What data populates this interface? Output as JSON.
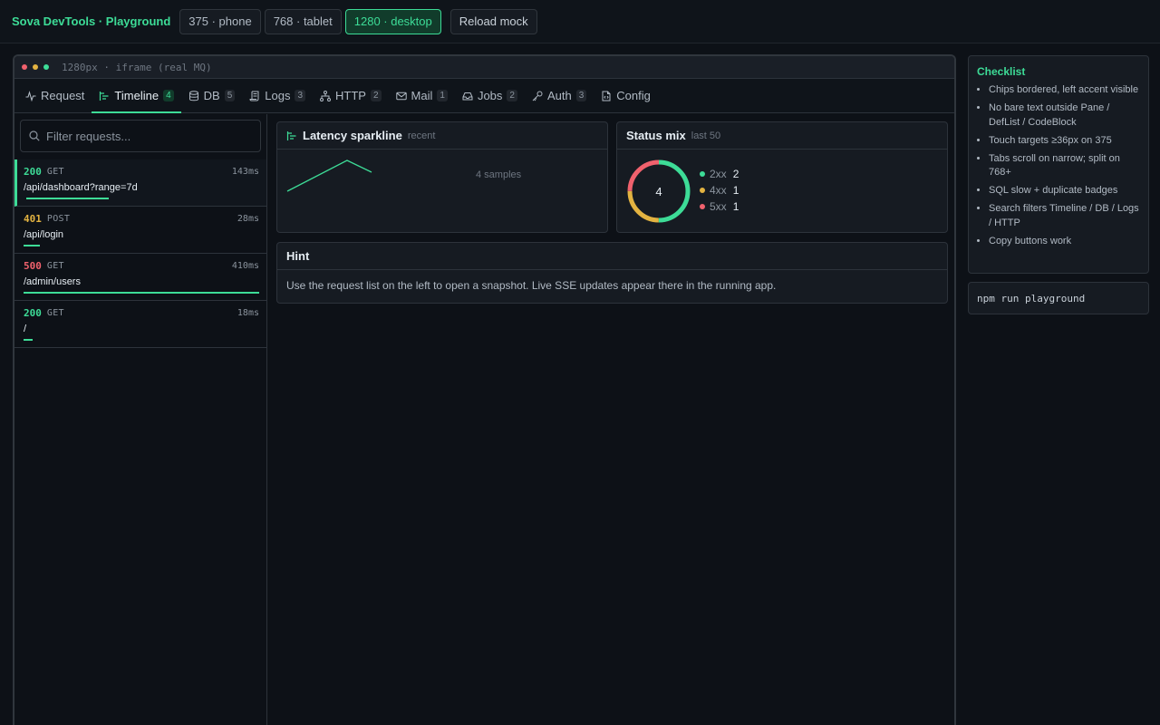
{
  "app": {
    "title": "Sova DevTools · Playground"
  },
  "viewports": [
    {
      "label": "375 · phone"
    },
    {
      "label": "768 · tablet"
    },
    {
      "label": "1280 · desktop"
    }
  ],
  "reload_label": "Reload mock",
  "frame": {
    "label": "1280px · iframe (real MQ)"
  },
  "tabs": [
    {
      "label": "Request",
      "badge": ""
    },
    {
      "label": "Timeline",
      "badge": "4"
    },
    {
      "label": "DB",
      "badge": "5"
    },
    {
      "label": "Logs",
      "badge": "3"
    },
    {
      "label": "HTTP",
      "badge": "2"
    },
    {
      "label": "Mail",
      "badge": "1"
    },
    {
      "label": "Jobs",
      "badge": "2"
    },
    {
      "label": "Auth",
      "badge": "3"
    },
    {
      "label": "Config",
      "badge": ""
    }
  ],
  "search": {
    "placeholder": "Filter requests..."
  },
  "requests": [
    {
      "status": "200",
      "method": "GET",
      "duration": "143ms",
      "path": "/api/dashboard?range=7d",
      "status_color": "#3ddc97",
      "duration_fraction": 0.35
    },
    {
      "status": "401",
      "method": "POST",
      "duration": "28ms",
      "path": "/api/login",
      "status_color": "#e3b341",
      "duration_fraction": 0.07
    },
    {
      "status": "500",
      "method": "GET",
      "duration": "410ms",
      "path": "/admin/users",
      "status_color": "#f0616d",
      "duration_fraction": 1.0
    },
    {
      "status": "200",
      "method": "GET",
      "duration": "18ms",
      "path": "/",
      "status_color": "#3ddc97",
      "duration_fraction": 0.04
    }
  ],
  "latency": {
    "title": "Latency sparkline",
    "subtitle": "recent",
    "samples_label": "4 samples"
  },
  "status_mix": {
    "title": "Status mix",
    "subtitle": "last 50",
    "total": "4",
    "items": [
      {
        "label": "2xx",
        "value": "2",
        "color": "#3ddc97"
      },
      {
        "label": "4xx",
        "value": "1",
        "color": "#e3b341"
      },
      {
        "label": "5xx",
        "value": "1",
        "color": "#f0616d"
      }
    ]
  },
  "hint": {
    "title": "Hint",
    "text": "Use the request list on the left to open a snapshot. Live SSE updates appear there in the running app."
  },
  "checklist": {
    "title": "Checklist",
    "items": [
      "Chips bordered, left accent visible",
      "No bare text outside Pane / DefList / CodeBlock",
      "Touch targets ≥36px on 375",
      "Tabs scroll on narrow; split on 768+",
      "SQL slow + duplicate badges",
      "Search filters Timeline / DB / Logs / HTTP",
      "Copy buttons work"
    ]
  },
  "command": "npm run playground",
  "colors": {
    "accent": "#3ddc97",
    "warn": "#e3b341",
    "error": "#f0616d"
  }
}
